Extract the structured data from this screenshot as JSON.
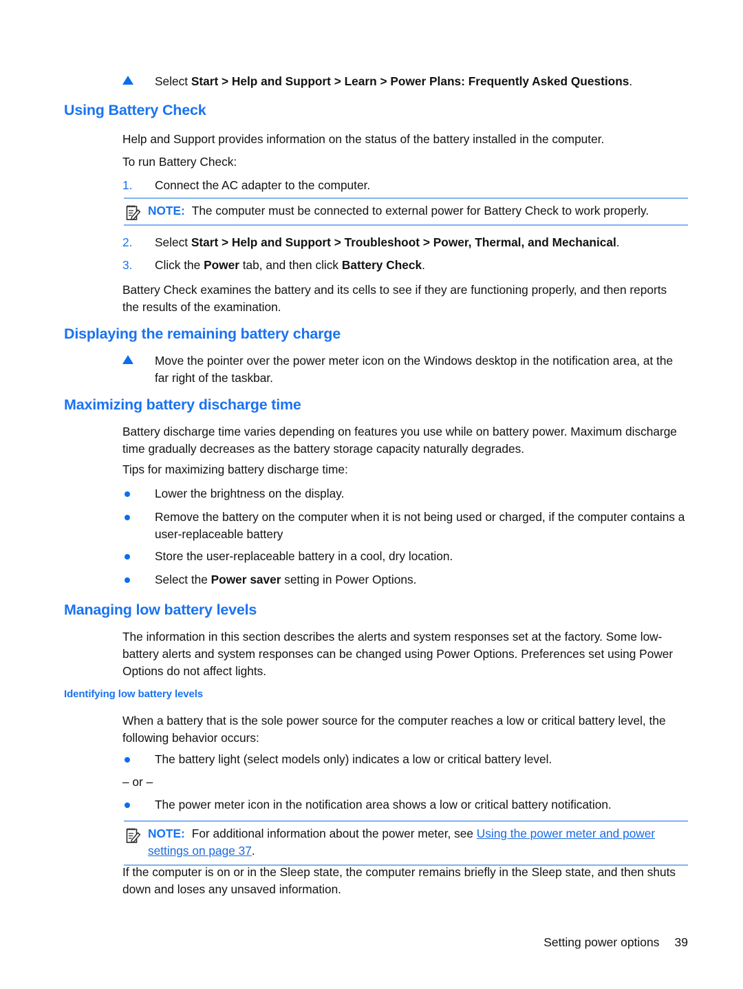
{
  "document": {
    "footer": {
      "section_label": "Setting power options",
      "page_number": "39"
    },
    "colors": {
      "heading_blue": "#1a73f0",
      "link_blue": "#1a6ae0",
      "rule_blue": "#7fb2f0",
      "marker_blue": "#0a6ef0",
      "body_black": "#121212"
    }
  },
  "blocks": {
    "intro_bullet": {
      "marker": "triangle-bullet",
      "text_prefix": "Select ",
      "text_bold": "Start > Help and Support > Learn > Power Plans: Frequently Asked Questions",
      "text_suffix": "."
    },
    "heading_using_battery_check": "Using Battery Check",
    "para_help_and_support": "Help and Support provides information on the status of the battery installed in the computer.",
    "para_to_run": "To run Battery Check:",
    "step1": {
      "number": "1.",
      "text": "Connect the AC adapter to the computer."
    },
    "note1": {
      "icon": "note-pencil-icon",
      "label": "NOTE:",
      "text": "The computer must be connected to external power for Battery Check to work properly."
    },
    "step2": {
      "number": "2.",
      "text_prefix": "Select ",
      "text_bold": "Start > Help and Support > Troubleshoot > Power, Thermal, and Mechanical",
      "text_suffix": "."
    },
    "step3": {
      "number": "3.",
      "text_prefix": "Click the ",
      "text_bold1": "Power",
      "text_mid": " tab, and then click ",
      "text_bold2": "Battery Check",
      "text_suffix": "."
    },
    "para_battery_check_examines": "Battery Check examines the battery and its cells to see if they are functioning properly, and then reports the results of the examination.",
    "heading_displaying_charge": "Displaying the remaining battery charge",
    "bullet_move_pointer": {
      "marker": "triangle-bullet",
      "text": "Move the pointer over the power meter icon on the Windows desktop in the notification area, at the far right of the taskbar."
    },
    "heading_maximizing_discharge": "Maximizing battery discharge time",
    "para_discharge_varies": "Battery discharge time varies depending on features you use while on battery power. Maximum discharge time gradually decreases as the battery storage capacity naturally degrades.",
    "para_tips_intro": "Tips for maximizing battery discharge time:",
    "tips": [
      {
        "text": "Lower the brightness on the display."
      },
      {
        "text": "Remove the battery on the computer when it is not being used or charged, if the computer contains a user-replaceable battery"
      },
      {
        "text": "Store the user-replaceable battery in a cool, dry location."
      },
      {
        "text_prefix": "Select the ",
        "text_bold": "Power saver",
        "text_suffix": " setting in Power Options."
      }
    ],
    "heading_managing_low_levels": "Managing low battery levels",
    "para_information_section": "The information in this section describes the alerts and system responses set at the factory. Some low-battery alerts and system responses can be changed using Power Options. Preferences set using Power Options do not affect lights.",
    "heading_identifying_low_levels": "Identifying low battery levels",
    "para_when_battery_sole": "When a battery that is the sole power source for the computer reaches a low or critical battery level, the following behavior occurs:",
    "bullet_battery_light": "The battery light (select models only) indicates a low or critical battery level.",
    "or_separator": "– or –",
    "bullet_power_meter": "The power meter icon in the notification area shows a low or critical battery notification.",
    "note2": {
      "icon": "note-pencil-icon",
      "label": "NOTE:",
      "text_prefix": "For additional information about the power meter, see ",
      "link_text": "Using the power meter and power settings on page 37",
      "text_suffix": "."
    },
    "para_sleep_state": "If the computer is on or in the Sleep state, the computer remains briefly in the Sleep state, and then shuts down and loses any unsaved information."
  }
}
